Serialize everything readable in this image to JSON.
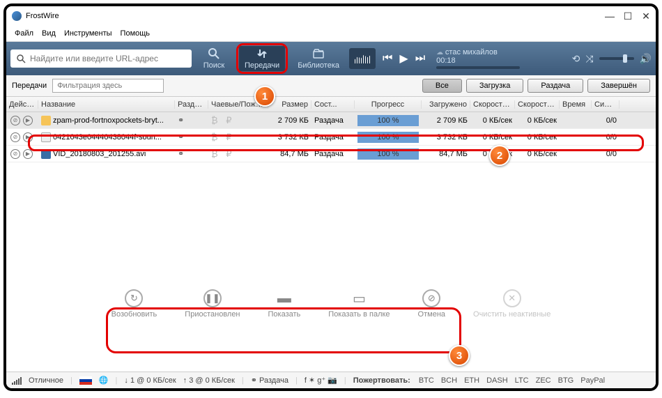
{
  "title": "FrostWire",
  "menu": {
    "file": "Файл",
    "view": "Вид",
    "tools": "Инструменты",
    "help": "Помощь"
  },
  "toolbar": {
    "searchPlaceholder": "Найдите или введите URL-адрес",
    "search": "Поиск",
    "transfers": "Передачи",
    "library": "Библиотека",
    "nowPlaying": "стас михайлов",
    "time": "00:18"
  },
  "sub": {
    "transfers": "Передачи",
    "filterPlaceholder": "Фильтрация здесь"
  },
  "tabs": {
    "all": "Все",
    "downloading": "Загрузка",
    "seeding": "Раздача",
    "finished": "Завершён"
  },
  "cols": {
    "act": "Дейст...",
    "name": "Название",
    "seed": "Раздача",
    "tip": "Чаевые/Пожерт...",
    "size": "Размер",
    "state": "Сост...",
    "prog": "Прогресс",
    "dl": "Загружено",
    "sp1": "Скорость ...",
    "sp2": "Скорость...",
    "time": "Время",
    "peers": "Сидов"
  },
  "rows": [
    {
      "name": "zpam-prod-fortnoxpockets-bryt...",
      "icon": "folder",
      "size": "2 709 КБ",
      "state": "Раздача",
      "prog": "100 %",
      "dl": "2 709 КБ",
      "sp1": "0 КБ/сек",
      "sp2": "0 КБ/сек",
      "time": "",
      "peers": "0/0"
    },
    {
      "name": "0421043e04440438044f-soun...",
      "icon": "text",
      "size": "3 732 КБ",
      "state": "Раздача",
      "prog": "100 %",
      "dl": "3 732 КБ",
      "sp1": "0 КБ/сек",
      "sp2": "0 КБ/сек",
      "time": "",
      "peers": "0/0"
    },
    {
      "name": "VID_20180803_201255.avi",
      "icon": "video",
      "size": "84,7 МБ",
      "state": "Раздача",
      "prog": "100 %",
      "dl": "84,7 МБ",
      "sp1": "0 КБ/сек",
      "sp2": "0 КБ/сек",
      "time": "",
      "peers": "0/0"
    }
  ],
  "actions": {
    "resume": "Возобновить",
    "pause": "Приостановлен",
    "show": "Показать",
    "showFolder": "Показать в палке",
    "cancel": "Отмена",
    "clear": "Очистить неактивные"
  },
  "status": {
    "quality": "Отличное",
    "down": "1 @ 0 КБ/сек",
    "up": "3 @ 0 КБ/сек",
    "seeding": "Раздача",
    "donate": "Пожертвовать:"
  },
  "coins": {
    "btc": "BTC",
    "bch": "BCH",
    "eth": "ETH",
    "dash": "DASH",
    "ltc": "LTC",
    "zec": "ZEC",
    "btg": "BTG",
    "paypal": "PayPal"
  }
}
